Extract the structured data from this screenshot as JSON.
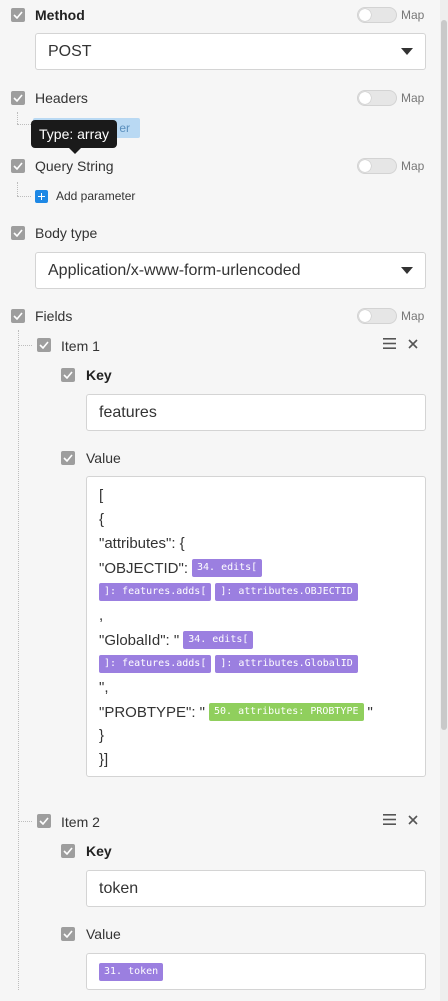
{
  "method": {
    "label": "Method",
    "map_label": "Map",
    "value": "POST"
  },
  "headers": {
    "label": "Headers",
    "map_label": "Map",
    "add_button_partial": "er"
  },
  "tooltip": {
    "text": "Type: array"
  },
  "query_string": {
    "label": "Query String",
    "map_label": "Map",
    "add_label": "Add parameter"
  },
  "body_type": {
    "label": "Body type",
    "value": "Application/x-www-form-urlencoded"
  },
  "fields": {
    "label": "Fields",
    "map_label": "Map",
    "items": [
      {
        "title": "Item 1",
        "key_label": "Key",
        "key_value": "features",
        "value_label": "Value",
        "value_lines": {
          "l1": "[",
          "l2": "{",
          "l3": "\"attributes\": {",
          "l4_text": "\"OBJECTID\":",
          "l4_pill": "34. edits[",
          "l5_pill_a": "]: features.adds[",
          "l5_pill_b": "]: attributes.OBJECTID",
          "l6": ",",
          "l7_text": "\"GlobalId\": \"",
          "l7_pill": "34. edits[",
          "l8_pill_a": "]: features.adds[",
          "l8_pill_b": "]: attributes.GlobalID",
          "l9": "\",",
          "l10_text": "\"PROBTYPE\": \"",
          "l10_pill": "50. attributes: PROBTYPE",
          "l10_tail": "\"",
          "l11": "}",
          "l12": "}]"
        }
      },
      {
        "title": "Item 2",
        "key_label": "Key",
        "key_value": "token",
        "value_label": "Value",
        "value_pill": "31. token"
      }
    ]
  },
  "colors": {
    "pill_purple": "#9b7fe0",
    "pill_green": "#90cf5d",
    "add_blue": "#1e88e5"
  }
}
